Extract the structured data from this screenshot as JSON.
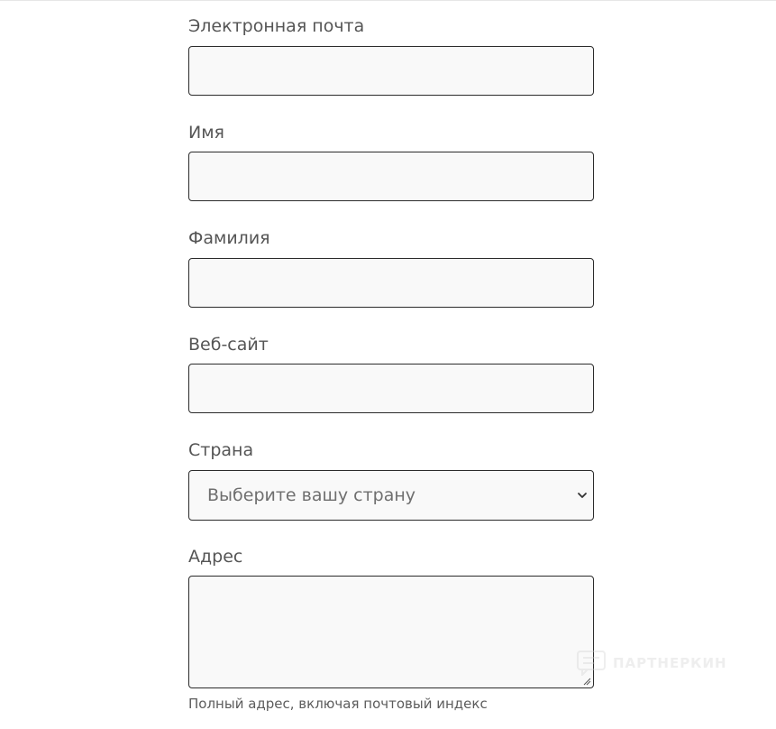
{
  "form": {
    "email": {
      "label": "Электронная почта",
      "value": ""
    },
    "first_name": {
      "label": "Имя",
      "value": ""
    },
    "last_name": {
      "label": "Фамилия",
      "value": ""
    },
    "website": {
      "label": "Веб-сайт",
      "value": ""
    },
    "country": {
      "label": "Страна",
      "selected": "Выберите вашу страну"
    },
    "address": {
      "label": "Адрес",
      "value": "",
      "help": "Полный адрес, включая почтовый индекс"
    }
  },
  "watermark": {
    "text": "ПАРТНЕРКИН",
    "icon": "chat-bubble-icon"
  },
  "colors": {
    "field_border": "#2b2b2b",
    "field_background": "#f9f9f9",
    "label_text": "#555555",
    "placeholder_text": "#6f6f6f"
  }
}
